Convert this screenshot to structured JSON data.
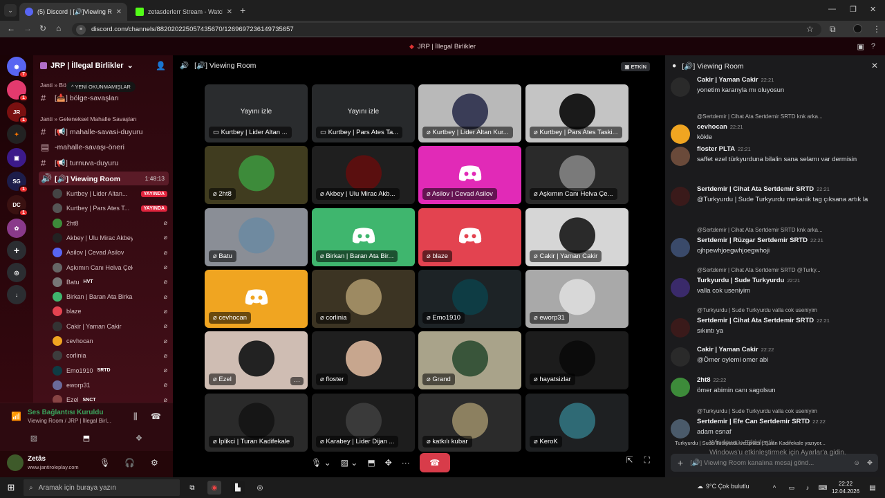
{
  "browser": {
    "tabs": [
      {
        "title": "(5) Discord | [🔊]Viewing R",
        "active": true
      },
      {
        "title": "zetasderlerr Stream - Watch Liv",
        "active": false
      }
    ],
    "url": "discord.com/channels/882020225057435670/1269697236149735657"
  },
  "discord_top_title": "JRP | İllegal Birlikler",
  "server": {
    "name": "JRP | İllegal Birlikler",
    "unread_pill": "YENİ OKUNMAMIŞLAR",
    "category1": "Janti » Bö",
    "chan_bolge": "[📥] bölge-savaşları",
    "category2": "Janti » Geleneksel Mahalle Savaşları",
    "chan_duyuru": "[📢] mahalle-savasi-duyuru",
    "chan_oneri": "-mahalle-savaşı-öneri",
    "chan_turnuva": "[📢] turnuva-duyuru",
    "voice_channel": "Viewing Room",
    "voice_time": "1:48:13",
    "voice_users": [
      {
        "name": "Kurtbey | Lider Altan...",
        "badge": "YAYINDA"
      },
      {
        "name": "Kurtbey | Pars Ates T...",
        "badge": "YAYINDA"
      },
      {
        "name": "2ht8",
        "badge": ""
      },
      {
        "name": "Akbey | Ulu Mirac Akbey",
        "badge": ""
      },
      {
        "name": "Asilov | Cevad Asilov",
        "badge": ""
      },
      {
        "name": "Aşkımın Canı Helva Çekmiş",
        "badge": ""
      },
      {
        "name": "Batu",
        "badge": "HVT"
      },
      {
        "name": "Birkan | Baran Ata Birkan",
        "badge": ""
      },
      {
        "name": "blaze",
        "badge": ""
      },
      {
        "name": "Cakir | Yaman Cakir",
        "badge": ""
      },
      {
        "name": "cevhocan",
        "badge": ""
      },
      {
        "name": "corlinia",
        "badge": ""
      },
      {
        "name": "Emo1910",
        "badge": "SRTD"
      },
      {
        "name": "eworp31",
        "badge": ""
      },
      {
        "name": "Ezel",
        "badge": "SNCT"
      }
    ]
  },
  "voice_panel": {
    "status": "Ses Bağlantısı Kuruldu",
    "location": "Viewing Room / JRP | İllegal Birl..."
  },
  "user": {
    "name": "Zetâs",
    "sub": "www.jantiroleplay.com"
  },
  "stage": {
    "title": "Viewing Room",
    "etkin": "ETKİN",
    "watch_label": "Yayını izle",
    "tiles": [
      {
        "name": "Kurtbey | Lider Altan ...",
        "color": "#2a2c2e",
        "kind": "stream"
      },
      {
        "name": "Kurtbey | Pars Ates Ta...",
        "color": "#27292b",
        "kind": "stream"
      },
      {
        "name": "Kurtbey | Lider Altan Kur...",
        "color": "#b9b9b9",
        "kind": "avatar",
        "av": "#3a3d57"
      },
      {
        "name": "Kurtbey | Pars Ates Taski...",
        "color": "#c4c4c4",
        "kind": "avatar",
        "av": "#1a1a1a"
      },
      {
        "name": "2ht8",
        "color": "#403c1f",
        "kind": "avatar",
        "av": "#3d8b3a"
      },
      {
        "name": "Akbey | Ulu Mirac Akb...",
        "color": "#1f1f1f",
        "kind": "avatar",
        "av": "#5a0f0f"
      },
      {
        "name": "Asilov | Cevad Asilov",
        "color": "#e12ab7",
        "kind": "discord"
      },
      {
        "name": "Aşkımın Canı Helva Çe...",
        "color": "#2a2a2a",
        "kind": "avatar",
        "av": "#7a7a7a"
      },
      {
        "name": "Batu",
        "color": "#8a8e96",
        "kind": "avatar",
        "av": "#6f8aa0"
      },
      {
        "name": "Birkan | Baran Ata Bir...",
        "color": "#3fb66e",
        "kind": "discord"
      },
      {
        "name": "blaze",
        "color": "#e34350",
        "kind": "discord"
      },
      {
        "name": "Cakir | Yaman Cakir",
        "color": "#d6d6d6",
        "kind": "avatar",
        "av": "#2a2a2a"
      },
      {
        "name": "cevhocan",
        "color": "#f0a521",
        "kind": "discord"
      },
      {
        "name": "corlinia",
        "color": "#3c3423",
        "kind": "avatar",
        "av": "#9d8a62"
      },
      {
        "name": "Emo1910",
        "color": "#1d2326",
        "kind": "avatar",
        "av": "#0e3c44"
      },
      {
        "name": "eworp31",
        "color": "#a9a9a9",
        "kind": "avatar",
        "av": "#d8d8d8"
      },
      {
        "name": "Ezel",
        "color": "#cfbdb3",
        "kind": "avatar",
        "av": "#222222"
      },
      {
        "name": "floster",
        "color": "#1f1f1f",
        "kind": "avatar",
        "av": "#c7a68e"
      },
      {
        "name": "Grand",
        "color": "#a9a38a",
        "kind": "avatar",
        "av": "#39553a"
      },
      {
        "name": "hayatsizlar",
        "color": "#1c1c1c",
        "kind": "avatar",
        "av": "#0b0b0b"
      },
      {
        "name": "İplikci | Turan Kadifekale",
        "color": "#2a2a2a",
        "kind": "avatar",
        "av": "#161616"
      },
      {
        "name": "Karabey | Lider Dijan ...",
        "color": "#1d1d1d",
        "kind": "avatar",
        "av": "#3a3a3a"
      },
      {
        "name": "katkılı kubar",
        "color": "#2b2b2b",
        "kind": "avatar",
        "av": "#8c8060"
      },
      {
        "name": "KeroK",
        "color": "#1e2022",
        "kind": "avatar",
        "av": "#2f6a75"
      }
    ],
    "more_label": "···"
  },
  "chat": {
    "title": "Viewing Room",
    "messages": [
      {
        "reply": "",
        "author": "Cakir | Yaman Cakir",
        "time": "22:21",
        "text": "yonetim kararıyla mı oluyosun",
        "av": "#2a2a2a"
      },
      {
        "reply": "@Sertdemir | Cihat Ata Sertdemir  SRTD  knk arka...",
        "author": "cevhocan",
        "time": "22:21",
        "text": "kökle",
        "av": "#f0a521"
      },
      {
        "reply": "",
        "author": "floster  PLTA",
        "time": "22:21",
        "text": "saffet ezel türkyurduna bilalin sana selamı var dermisin",
        "av": "#6a4a3a"
      },
      {
        "reply": "",
        "author": "Sertdemir | Cihat Ata Sertdemir  SRTD",
        "time": "22:21",
        "text": "@Turkyurdu | Sude Turkyurdu mekanik tag çıksana artık la",
        "av": "#3a1a1a"
      },
      {
        "reply": "@Sertdemir | Cihat Ata Sertdemir  SRTD  knk arka...",
        "author": "Sertdemir | Rüzgar Sertdemir  SRTD",
        "time": "22:21",
        "text": "ojhpewhjoegwhjoegwhoji",
        "av": "#3a4a6a"
      },
      {
        "reply": "@Sertdemir | Cihat Ata Sertdemir  SRTD  @Turky...",
        "author": "Turkyurdu | Sude Turkyurdu",
        "time": "22:21",
        "text": "valla cok useniyim",
        "av": "#3a2a6a"
      },
      {
        "reply": "@Turkyurdu | Sude Turkyurdu  valla cok useniyim",
        "author": "Sertdemir | Cihat Ata Sertdemir  SRTD",
        "time": "22:21",
        "text": "sıkıntı ya",
        "av": "#3a1a1a"
      },
      {
        "reply": "",
        "author": "Cakir | Yaman Cakir",
        "time": "22:22",
        "text": "@Ömer oylemi omer abi",
        "av": "#2a2a2a"
      },
      {
        "reply": "",
        "author": "2ht8",
        "time": "22:22",
        "text": "ömer abimin canı sagolsun",
        "av": "#3d8b3a"
      },
      {
        "reply": "@Turkyurdu | Sude Turkyurdu  valla cok useniyim",
        "author": "Sertdemir | Efe Can Sertdemir  SRTD",
        "time": "22:22",
        "text": "adam esnaf",
        "av": "#4a5a6a"
      }
    ],
    "typing": "Turkyurdu | Sude Turkyurdu ve İplikci | Turan Kadifekale yazıyor...",
    "composer_placeholder": "[🔊] Viewing Room kanalına mesaj gönd...",
    "watermark_line1": "Windows'u Etkinleştir",
    "watermark_line2": "Windows'u etkinleştirmek için Ayarlar'a gidin."
  },
  "taskbar": {
    "search": "Aramak için buraya yazın",
    "weather": "9°C  Çok bulutlu",
    "time": "22:22",
    "date": "12.04.2026"
  },
  "colors": {
    "accent": "#5865f2",
    "live": "#e0243d",
    "hangup": "#d83c4a"
  }
}
